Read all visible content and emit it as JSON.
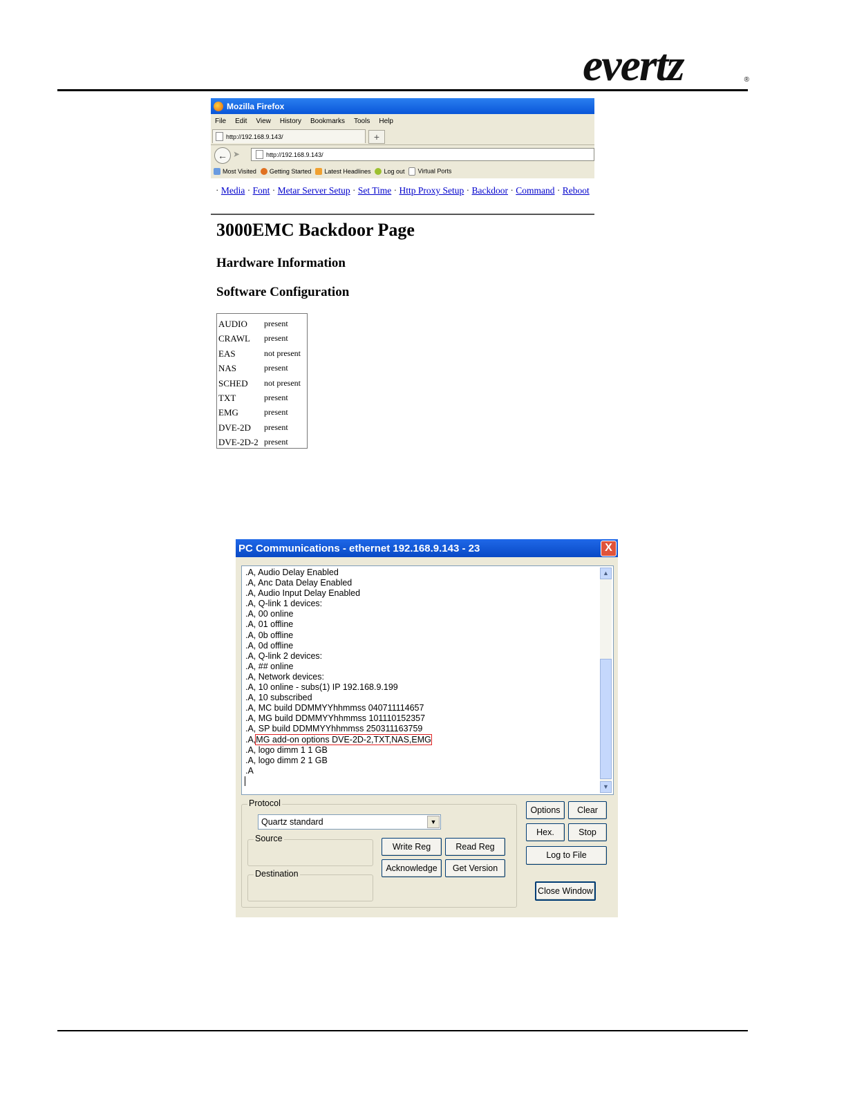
{
  "header": {
    "logo_text": "evertz",
    "logo_mark": "®"
  },
  "firefox": {
    "window_title": "Mozilla Firefox",
    "menu": [
      "File",
      "Edit",
      "View",
      "History",
      "Bookmarks",
      "Tools",
      "Help"
    ],
    "tab_title": "http://192.168.9.143/",
    "new_tab": "+",
    "address": "http://192.168.9.143/",
    "bookmarks": [
      "Most Visited",
      "Getting Started",
      "Latest Headlines",
      "Log out",
      "Virtual Ports"
    ],
    "links": [
      "Media",
      "Font",
      "Metar Server Setup",
      "Set Time",
      "Http Proxy Setup",
      "Backdoor",
      "Command",
      "Reboot"
    ]
  },
  "page": {
    "title": "3000EMC Backdoor Page",
    "hardware_heading": "Hardware Information",
    "software_heading": "Software Configuration",
    "options": [
      {
        "name": "AUDIO",
        "status": "present"
      },
      {
        "name": "CRAWL",
        "status": "present"
      },
      {
        "name": "EAS",
        "status": "not present"
      },
      {
        "name": "NAS",
        "status": "present"
      },
      {
        "name": "SCHED",
        "status": "not present"
      },
      {
        "name": "TXT",
        "status": "present"
      },
      {
        "name": "EMG",
        "status": "present"
      },
      {
        "name": "DVE-2D",
        "status": "present"
      },
      {
        "name": "DVE-2D-2",
        "status": "present"
      }
    ]
  },
  "pc": {
    "title": "PC Communications - ethernet 192.168.9.143 - 23",
    "close": "X",
    "log_lines": [
      ".A, Audio Delay Enabled",
      ".A, Anc Data Delay Enabled",
      ".A, Audio Input Delay Enabled",
      ".A, Q-link 1 devices:",
      ".A,  00 online",
      ".A,  01 offline",
      ".A,  0b offline",
      ".A,  0d offline",
      ".A, Q-link 2 devices:",
      ".A,  ## online",
      ".A, Network devices:",
      ".A,  10 online  - subs(1) IP 192.168.9.199",
      ".A, 10 subscribed",
      ".A, MC build DDMMYYhhmmss 040711114657",
      ".A, MG build DDMMYYhhmmss 101110152357",
      ".A, SP build DDMMYYhhmmss 250311163759",
      ".A, MG add-on options DVE-2D-2,TXT,NAS,EMG",
      ".A, logo dimm 1 1 GB",
      ".A, logo dimm 2 1 GB",
      ".A"
    ],
    "log_prefix_16": ".A,",
    "log_highlight_16": "MG add-on options DVE-2D-2,TXT,NAS,EMG",
    "protocol_label": "Protocol",
    "protocol_value": "Quartz standard",
    "source_label": "Source",
    "destination_label": "Destination",
    "buttons": {
      "write_reg": "Write Reg",
      "read_reg": "Read Reg",
      "acknowledge": "Acknowledge",
      "get_version": "Get Version",
      "options": "Options",
      "clear": "Clear",
      "hex": "Hex.",
      "stop": "Stop",
      "log_to_file": "Log to File",
      "close_window": "Close Window"
    }
  }
}
